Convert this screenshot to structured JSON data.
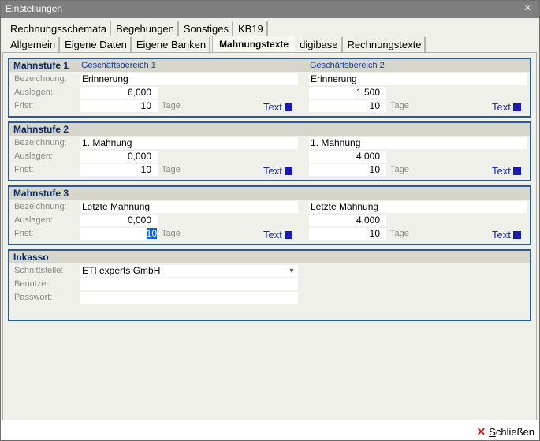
{
  "window": {
    "title": "Einstellungen",
    "close_glyph": "×"
  },
  "tabs_row1": [
    "Rechnungsschemata",
    "Begehungen",
    "Sonstiges",
    "KB19"
  ],
  "tabs_row2": [
    "Allgemein",
    "Eigene Daten",
    "Eigene Banken",
    "Mahnungstexte",
    "digibase",
    "Rechnungstexte"
  ],
  "active_tab": "Mahnungstexte",
  "labels": {
    "bezeichnung": "Bezeichnung:",
    "auslagen": "Auslagen:",
    "frist": "Frist:",
    "tage": "Tage",
    "text_button": "Text"
  },
  "mahnstufe1": {
    "title": "Mahnstufe 1",
    "gb1": {
      "header": "Geschäftsbereich 1",
      "bezeichnung": "Erinnerung",
      "auslagen": "6,000",
      "frist": "10"
    },
    "gb2": {
      "header": "Geschäftsbereich 2",
      "bezeichnung": "Erinnerung",
      "auslagen": "1,500",
      "frist": "10"
    }
  },
  "mahnstufe2": {
    "title": "Mahnstufe 2",
    "gb1": {
      "bezeichnung": "1. Mahnung",
      "auslagen": "0,000",
      "frist": "10"
    },
    "gb2": {
      "bezeichnung": "1. Mahnung",
      "auslagen": "4,000",
      "frist": "10"
    }
  },
  "mahnstufe3": {
    "title": "Mahnstufe 3",
    "gb1": {
      "bezeichnung": "Letzte Mahnung",
      "auslagen": "0,000",
      "frist": "10"
    },
    "gb2": {
      "bezeichnung": "Letzte Mahnung",
      "auslagen": "4,000",
      "frist": "10"
    }
  },
  "inkasso": {
    "title": "Inkasso",
    "schnittstelle_label": "Schnittstelle:",
    "schnittstelle_value": "ETI experts GmbH",
    "benutzer_label": "Benutzer:",
    "benutzer_value": "",
    "passwort_label": "Passwort:",
    "passwort_value": ""
  },
  "footer": {
    "close_label_first": "S",
    "close_label_rest": "chließen"
  },
  "colors": {
    "accent": "#2e5a8e",
    "text_button": "#1a2ab0",
    "close_x": "#c01818"
  }
}
